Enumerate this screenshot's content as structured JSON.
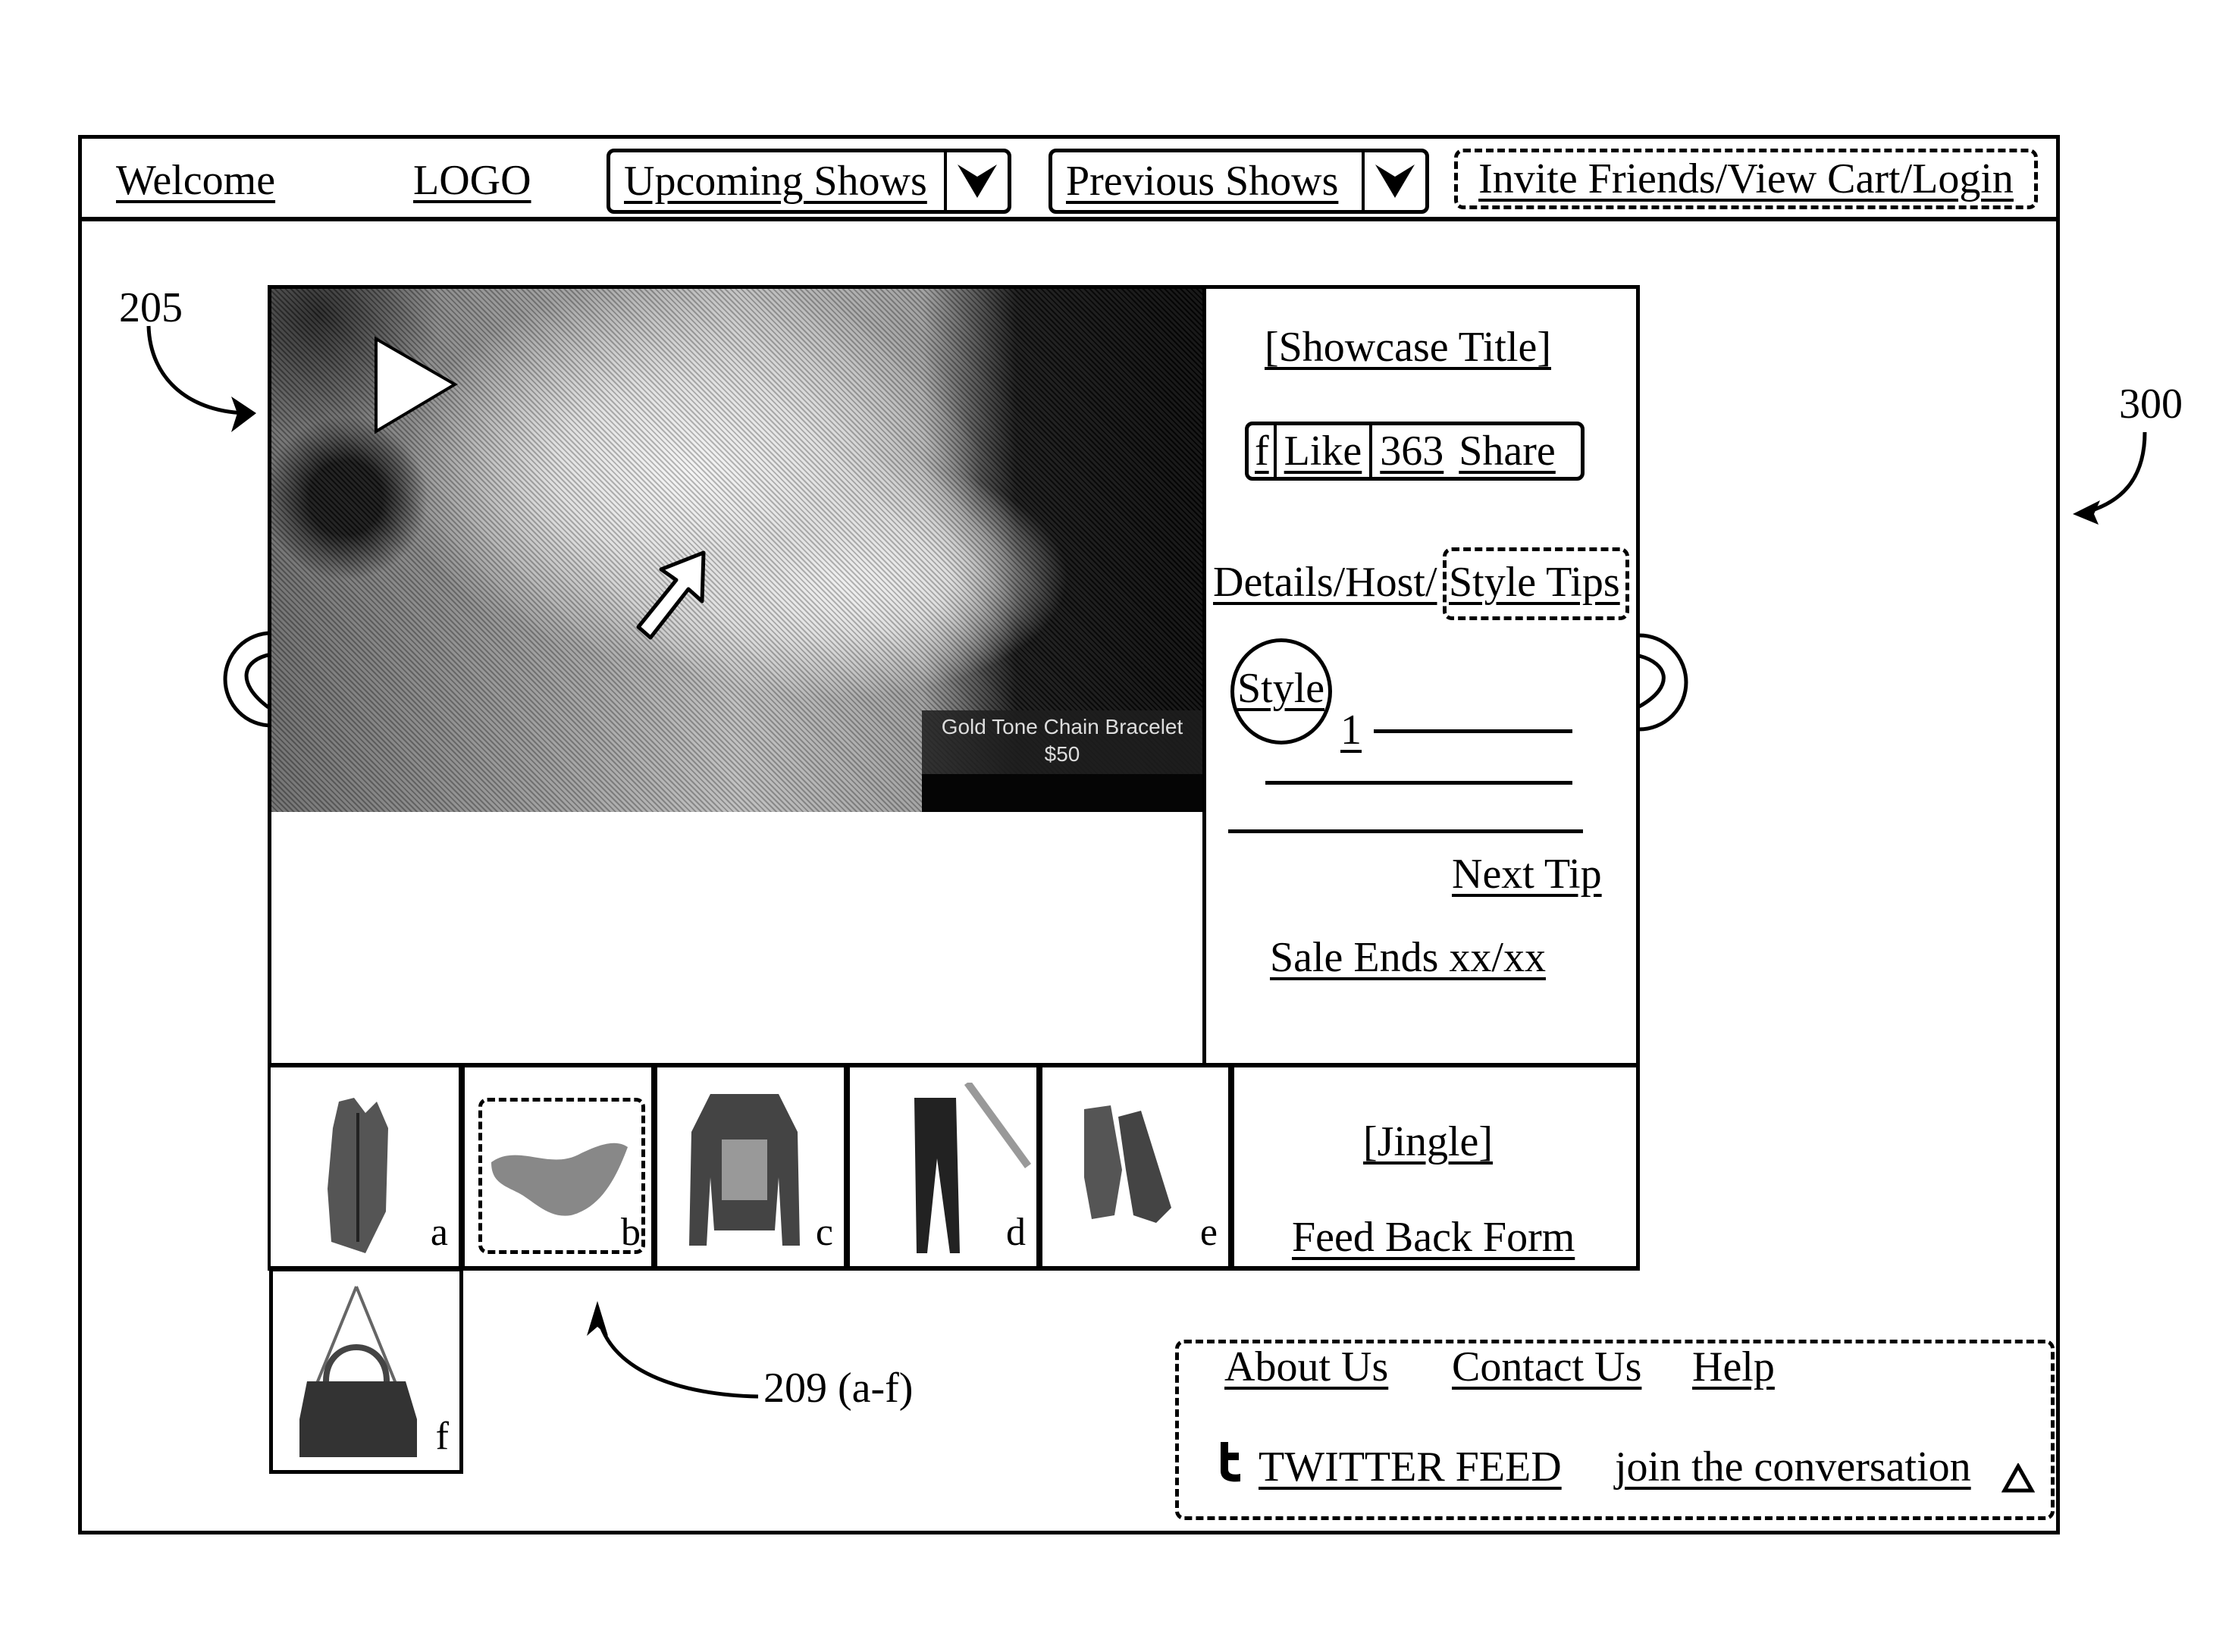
{
  "header": {
    "welcome": "Welcome",
    "logo": "LOGO",
    "upcoming_shows": "Upcoming Shows",
    "previous_shows": "Previous Shows",
    "account_links": "Invite Friends/View Cart/Login"
  },
  "showcase": {
    "title": "[Showcase Title]",
    "social": {
      "facebook_icon": "f",
      "like_label": "Like",
      "like_count": "363",
      "share_label": "Share"
    },
    "tabs": {
      "details_host": "Details/Host/",
      "style_tips": "Style Tips",
      "active": "Style Tips"
    },
    "style_badge": "Style",
    "tip_number": "1",
    "next_tip": "Next Tip",
    "sale_ends": "Sale Ends xx/xx"
  },
  "video": {
    "play_icon": "play-icon",
    "product_caption": "Gold Tone Chain Bracelet",
    "product_price": "$50"
  },
  "products": {
    "items": [
      {
        "letter": "a",
        "name": "vest"
      },
      {
        "letter": "b",
        "name": "scarf",
        "selected": true
      },
      {
        "letter": "c",
        "name": "jacket"
      },
      {
        "letter": "d",
        "name": "pants"
      },
      {
        "letter": "e",
        "name": "boots"
      },
      {
        "letter": "f",
        "name": "handbag"
      }
    ],
    "jingle": "[Jingle]",
    "feedback": "Feed Back Form"
  },
  "footer": {
    "about": "About Us",
    "contact": "Contact Us",
    "help": "Help",
    "twitter_icon": "t",
    "twitter_feed": "TWITTER FEED",
    "join": "join the conversation"
  },
  "callouts": {
    "video_ref": "205",
    "page_ref": "300",
    "products_ref": "209 (a-f)"
  }
}
